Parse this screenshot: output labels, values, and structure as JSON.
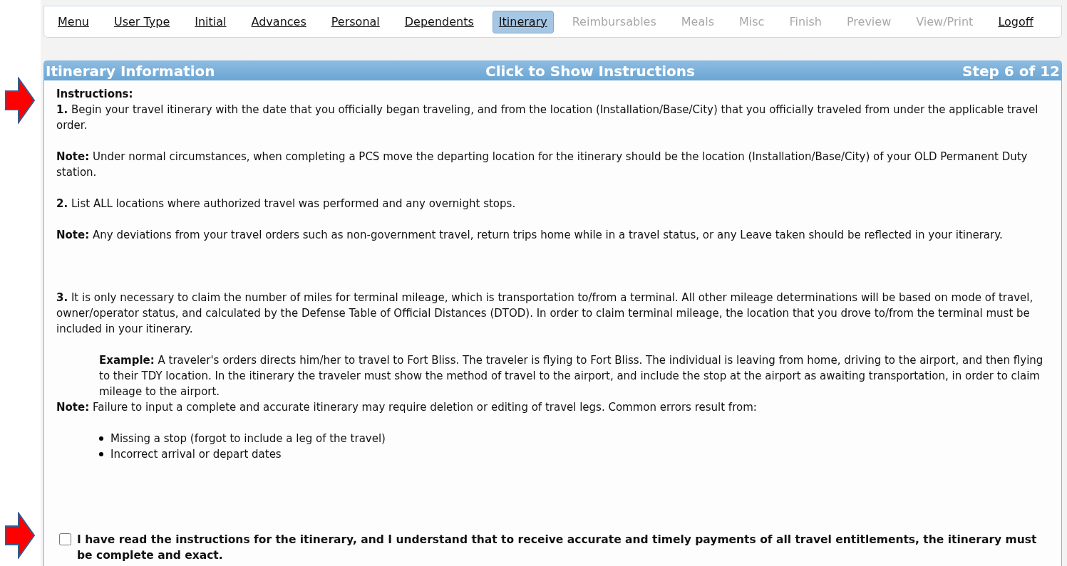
{
  "nav": [
    {
      "label": "Menu",
      "selected": false,
      "disabled": false
    },
    {
      "label": "User Type",
      "selected": false,
      "disabled": false
    },
    {
      "label": "Initial",
      "selected": false,
      "disabled": false
    },
    {
      "label": "Advances",
      "selected": false,
      "disabled": false
    },
    {
      "label": "Personal",
      "selected": false,
      "disabled": false
    },
    {
      "label": "Dependents",
      "selected": false,
      "disabled": false
    },
    {
      "label": "Itinerary",
      "selected": true,
      "disabled": false
    },
    {
      "label": "Reimbursables",
      "selected": false,
      "disabled": true
    },
    {
      "label": "Meals",
      "selected": false,
      "disabled": true
    },
    {
      "label": "Misc",
      "selected": false,
      "disabled": true
    },
    {
      "label": "Finish",
      "selected": false,
      "disabled": true
    },
    {
      "label": "Preview",
      "selected": false,
      "disabled": true
    },
    {
      "label": "View/Print",
      "selected": false,
      "disabled": true
    },
    {
      "label": "Logoff",
      "selected": false,
      "disabled": false
    }
  ],
  "panel": {
    "title": "Itinerary Information",
    "toggle": "Click to Show Instructions",
    "step": "Step 6 of 12"
  },
  "instructions": {
    "heading": "Instructions:",
    "blocks": [
      {
        "kind": "para",
        "text": "**1.** Begin your travel itinerary with the date that you officially began traveling, and from the location (Installation/Base/City) that you officially traveled from under the applicable travel order."
      },
      {
        "kind": "para",
        "text": "**Note:** Under normal circumstances, when completing a PCS move the departing location for the itinerary should be the location (Installation/Base/City) of your OLD Permanent Duty station."
      },
      {
        "kind": "para",
        "text": "**2.** List ALL locations where authorized travel was performed and any overnight stops."
      },
      {
        "kind": "para",
        "text": "**Note:** Any deviations from your travel orders such as non-government travel, return trips home while in a travel status, or any Leave taken should be reflected in your itinerary."
      },
      {
        "kind": "spaced",
        "text": "**3.** It is only necessary to claim the number of miles for terminal mileage, which is transportation to/from a terminal. All other mileage determinations will be based on mode of travel, owner/operator status, and calculated by the Defense Table of Official Distances (DTOD). In order to claim terminal mileage, the location that you drove to/from the terminal must be included in your itinerary."
      },
      {
        "kind": "example",
        "text": "**Example:** A traveler's orders directs him/her to travel to Fort Bliss. The traveler is flying to Fort Bliss. The individual is leaving from home, driving to the airport, and then flying to their TDY location. In the itinerary the traveler must show the method of travel to the airport, and include the stop at the airport as awaiting transportation, in order to claim mileage to the airport."
      },
      {
        "kind": "tight",
        "text": "**Note:** Failure to input a complete and accurate itinerary may require deletion or editing of travel legs. Common errors result from:"
      },
      {
        "kind": "list",
        "items": [
          "Missing a stop (forgot to include a leg of the travel)",
          "Incorrect arrival or depart dates"
        ]
      }
    ]
  },
  "acknowledge": {
    "label": "I have read the instructions for the itinerary, and I understand that to receive accurate and timely payments of all travel entitlements, the itinerary must be complete and exact.",
    "checked": false
  }
}
